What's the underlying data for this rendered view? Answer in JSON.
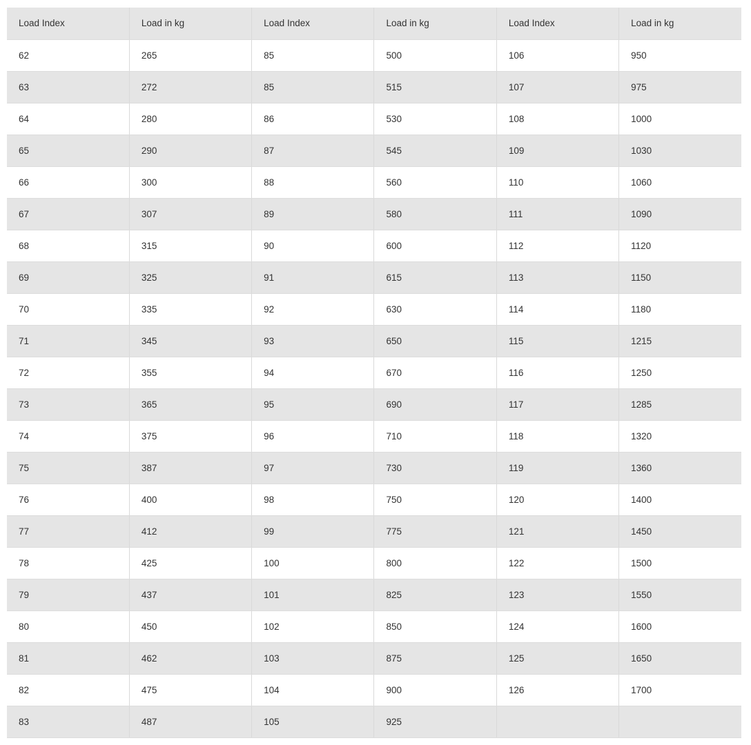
{
  "table": {
    "headers": [
      "Load Index",
      "Load in kg",
      "Load Index",
      "Load in kg",
      "Load Index",
      "Load in kg"
    ],
    "rows": [
      [
        "62",
        "265",
        "85",
        "500",
        "106",
        "950"
      ],
      [
        "63",
        "272",
        "85",
        "515",
        "107",
        "975"
      ],
      [
        "64",
        "280",
        "86",
        "530",
        "108",
        "1000"
      ],
      [
        "65",
        "290",
        "87",
        "545",
        "109",
        "1030"
      ],
      [
        "66",
        "300",
        "88",
        "560",
        "110",
        "1060"
      ],
      [
        "67",
        "307",
        "89",
        "580",
        "111",
        "1090"
      ],
      [
        "68",
        "315",
        "90",
        "600",
        "112",
        "1120"
      ],
      [
        "69",
        "325",
        "91",
        "615",
        "113",
        "1150"
      ],
      [
        "70",
        "335",
        "92",
        "630",
        "114",
        "1180"
      ],
      [
        "71",
        "345",
        "93",
        "650",
        "115",
        "1215"
      ],
      [
        "72",
        "355",
        "94",
        "670",
        "116",
        "1250"
      ],
      [
        "73",
        "365",
        "95",
        "690",
        "117",
        "1285"
      ],
      [
        "74",
        "375",
        "96",
        "710",
        "118",
        "1320"
      ],
      [
        "75",
        "387",
        "97",
        "730",
        "119",
        "1360"
      ],
      [
        "76",
        "400",
        "98",
        "750",
        "120",
        "1400"
      ],
      [
        "77",
        "412",
        "99",
        "775",
        "121",
        "1450"
      ],
      [
        "78",
        "425",
        "100",
        "800",
        "122",
        "1500"
      ],
      [
        "79",
        "437",
        "101",
        "825",
        "123",
        "1550"
      ],
      [
        "80",
        "450",
        "102",
        "850",
        "124",
        "1600"
      ],
      [
        "81",
        "462",
        "103",
        "875",
        "125",
        "1650"
      ],
      [
        "82",
        "475",
        "104",
        "900",
        "126",
        "1700"
      ],
      [
        "83",
        "487",
        "105",
        "925",
        "",
        ""
      ]
    ]
  },
  "colors": {
    "header_bg": "#e5e5e5",
    "stripe_bg": "#e5e5e5",
    "row_bg": "#ffffff",
    "text": "#333333",
    "border": "#d9d9d9"
  }
}
